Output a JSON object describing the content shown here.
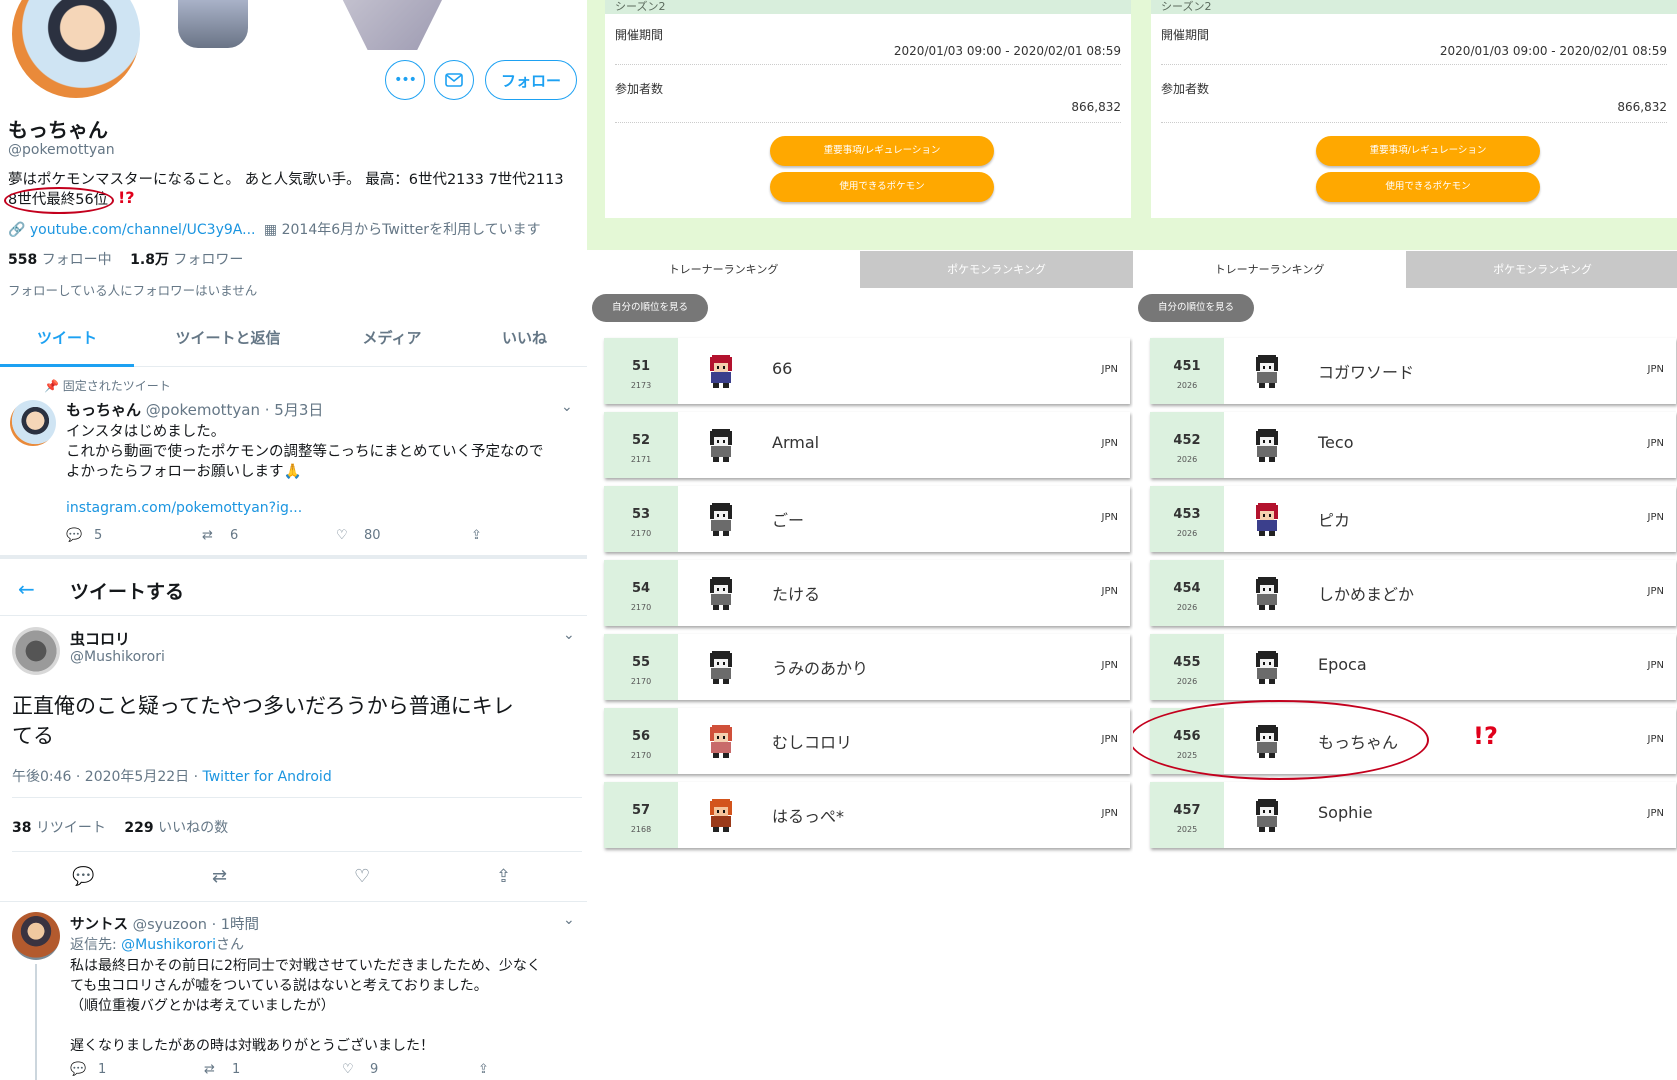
{
  "twitter": {
    "profile": {
      "name": "もっちゃん",
      "handle": "@pokemottyan",
      "bio_line1": "夢はポケモンマスターになること。 あと人気歌い手。 最高：6世代2133 7世代2113",
      "bio_line2": "8世代最終56位",
      "annotation_mark": "!?",
      "link": "youtube.com/channel/UC3y9A...",
      "joined": "2014年6月からTwitterを利用しています",
      "following_count": "558",
      "following_label": "フォロー中",
      "followers_count": "1.8万",
      "followers_label": "フォロワー",
      "mutual_note": "フォローしている人にフォロワーはいません",
      "follow_button": "フォロー"
    },
    "tabs": [
      "ツイート",
      "ツイートと返信",
      "メディア",
      "いいね"
    ],
    "pinned": {
      "pinned_label": "固定されたツイート",
      "name": "もっちゃん",
      "handle_date": "@pokemottyan · 5月3日",
      "line1": "インスタはじめました。",
      "line2": "これから動画で使ったポケモンの調整等こっちにまとめていく予定なので",
      "line3": "よかったらフォローお願いします🙏",
      "link": "instagram.com/pokemottyan?ig...",
      "replies": "5",
      "retweets": "6",
      "likes": "80"
    },
    "thread": {
      "header": "ツイートする",
      "name": "虫コロリ",
      "handle": "@Mushikorori",
      "text_line1": "正直俺のこと疑ってたやつ多いだろうから普通にキレ",
      "text_line2": "てる",
      "time": "午後0:46 · 2020年5月22日 · ",
      "source": "Twitter for Android",
      "retweet_count": "38",
      "retweet_label": "リツイート",
      "like_count": "229",
      "like_label": "いいねの数"
    },
    "reply": {
      "name": "サントス",
      "handle_time": "@syuzoon · 1時間",
      "reply_to_prefix": "返信先: ",
      "reply_to_user": "@Mushikorori",
      "reply_to_suffix": "さん",
      "line1": "私は最終日かその前日に2桁同士で対戦させていただきましたため、少なく",
      "line2": "ても虫コロリさんが嘘をついている説はないと考えておりました。",
      "line3": "（順位重複バグとかは考えていましたが）",
      "line4": "遅くなりましたがあの時は対戦ありがとうございました！",
      "replies": "1",
      "retweets": "1",
      "likes": "9"
    }
  },
  "ranking_panels": [
    {
      "season_tag": "シーズン2",
      "period_label": "開催期間",
      "period_value": "2020/01/03 09:00 - 2020/02/01 08:59",
      "participants_label": "参加者数",
      "participants_value": "866,832",
      "btn_rules": "重要事項/レギュレーション",
      "btn_pokemon": "使用できるポケモン",
      "tab_trainer": "トレーナーランキング",
      "tab_pokemon": "ポケモンランキング",
      "my_rank_btn": "自分の順位を見る",
      "rows": [
        {
          "rank": "51",
          "rate": "2173",
          "name": "66",
          "country": "JPN",
          "sprite": "trainer-red"
        },
        {
          "rank": "52",
          "rate": "2171",
          "name": "Armal",
          "country": "JPN",
          "sprite": "default"
        },
        {
          "rank": "53",
          "rate": "2170",
          "name": "ごー",
          "country": "JPN",
          "sprite": "default"
        },
        {
          "rank": "54",
          "rate": "2170",
          "name": "たける",
          "country": "JPN",
          "sprite": "default"
        },
        {
          "rank": "55",
          "rate": "2170",
          "name": "うみのあかり",
          "country": "JPN",
          "sprite": "default"
        },
        {
          "rank": "56",
          "rate": "2170",
          "name": "むしコロリ",
          "country": "JPN",
          "sprite": "girl-red"
        },
        {
          "rank": "57",
          "rate": "2168",
          "name": "はるっぺ*",
          "country": "JPN",
          "sprite": "boy-orange"
        }
      ]
    },
    {
      "season_tag": "シーズン2",
      "period_label": "開催期間",
      "period_value": "2020/01/03 09:00 - 2020/02/01 08:59",
      "participants_label": "参加者数",
      "participants_value": "866,832",
      "btn_rules": "重要事項/レギュレーション",
      "btn_pokemon": "使用できるポケモン",
      "tab_trainer": "トレーナーランキング",
      "tab_pokemon": "ポケモンランキング",
      "my_rank_btn": "自分の順位を見る",
      "highlight_mark": "!?",
      "rows": [
        {
          "rank": "451",
          "rate": "2026",
          "name": "コガワソード",
          "country": "JPN",
          "sprite": "default"
        },
        {
          "rank": "452",
          "rate": "2026",
          "name": "Teco",
          "country": "JPN",
          "sprite": "default"
        },
        {
          "rank": "453",
          "rate": "2026",
          "name": "ピカ",
          "country": "JPN",
          "sprite": "trainer-red"
        },
        {
          "rank": "454",
          "rate": "2026",
          "name": "しかめまどか",
          "country": "JPN",
          "sprite": "default"
        },
        {
          "rank": "455",
          "rate": "2026",
          "name": "Epoca",
          "country": "JPN",
          "sprite": "default"
        },
        {
          "rank": "456",
          "rate": "2025",
          "name": "もっちゃん",
          "country": "JPN",
          "sprite": "default"
        },
        {
          "rank": "457",
          "rate": "2025",
          "name": "Sophie",
          "country": "JPN",
          "sprite": "default"
        }
      ]
    }
  ],
  "colors": {
    "twitter_blue": "#1da1f2",
    "annotation_red": "#c3001d",
    "rank_green": "#dcf1df",
    "panel_bg_green": "#e4f8d6",
    "button_orange": "#ffa800"
  }
}
